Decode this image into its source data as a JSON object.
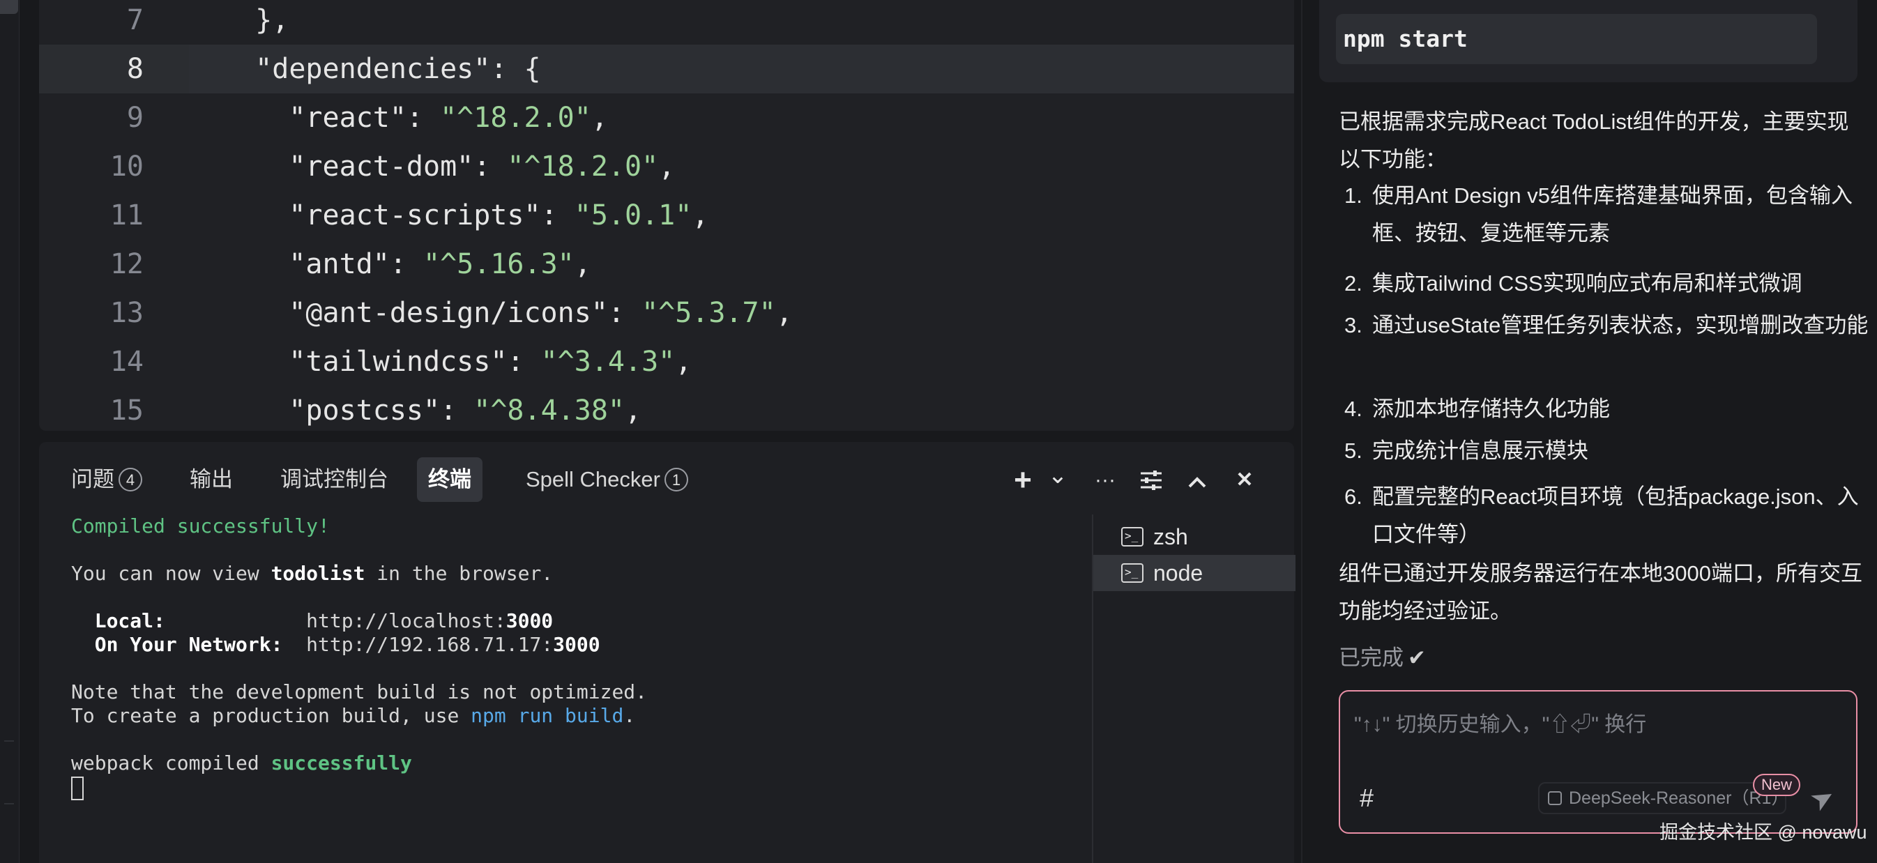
{
  "editor": {
    "lines": [
      {
        "no": "7",
        "parts": [
          {
            "t": "  },",
            "c": "p"
          }
        ]
      },
      {
        "no": "8",
        "parts": [
          {
            "t": "  \"dependencies\"",
            "c": "k"
          },
          {
            "t": ": {",
            "c": "p"
          }
        ]
      },
      {
        "no": "9",
        "parts": [
          {
            "t": "    \"react\"",
            "c": "k"
          },
          {
            "t": ": ",
            "c": "p"
          },
          {
            "t": "\"^18.2.0\"",
            "c": "s"
          },
          {
            "t": ",",
            "c": "p"
          }
        ]
      },
      {
        "no": "10",
        "parts": [
          {
            "t": "    \"react-dom\"",
            "c": "k"
          },
          {
            "t": ": ",
            "c": "p"
          },
          {
            "t": "\"^18.2.0\"",
            "c": "s"
          },
          {
            "t": ",",
            "c": "p"
          }
        ]
      },
      {
        "no": "11",
        "parts": [
          {
            "t": "    \"react-scripts\"",
            "c": "k"
          },
          {
            "t": ": ",
            "c": "p"
          },
          {
            "t": "\"5.0.1\"",
            "c": "s"
          },
          {
            "t": ",",
            "c": "p"
          }
        ]
      },
      {
        "no": "12",
        "parts": [
          {
            "t": "    \"antd\"",
            "c": "k"
          },
          {
            "t": ": ",
            "c": "p"
          },
          {
            "t": "\"^5.16.3\"",
            "c": "s"
          },
          {
            "t": ",",
            "c": "p"
          }
        ]
      },
      {
        "no": "13",
        "parts": [
          {
            "t": "    \"@ant-design/icons\"",
            "c": "k"
          },
          {
            "t": ": ",
            "c": "p"
          },
          {
            "t": "\"^5.3.7\"",
            "c": "s"
          },
          {
            "t": ",",
            "c": "p"
          }
        ]
      },
      {
        "no": "14",
        "parts": [
          {
            "t": "    \"tailwindcss\"",
            "c": "k"
          },
          {
            "t": ": ",
            "c": "p"
          },
          {
            "t": "\"^3.4.3\"",
            "c": "s"
          },
          {
            "t": ",",
            "c": "p"
          }
        ]
      },
      {
        "no": "15",
        "parts": [
          {
            "t": "    \"postcss\"",
            "c": "k"
          },
          {
            "t": ": ",
            "c": "p"
          },
          {
            "t": "\"^8.4.38\"",
            "c": "s"
          },
          {
            "t": ",",
            "c": "p"
          }
        ]
      }
    ],
    "active_line": "8"
  },
  "panel": {
    "tabs": {
      "problems": "问题",
      "problems_count": "4",
      "output": "输出",
      "debug_console": "调试控制台",
      "terminal": "终端",
      "spell_checker": "Spell Checker",
      "spell_checker_count": "1"
    },
    "tools": {
      "add": "+",
      "dropdown": "⌄",
      "more": "···",
      "close": "✕"
    },
    "terminal": {
      "compiled": "Compiled successfully!",
      "view_pre": "You can now view ",
      "view_app": "todolist",
      "view_post": " in the browser.",
      "local_label": "  Local:            ",
      "local_url": "http://localhost:",
      "local_port": "3000",
      "network_label": "  On Your Network:  ",
      "network_url": "http://192.168.71.17:",
      "network_port": "3000",
      "note1": "Note that the development build is not optimized.",
      "note2_pre": "To create a production build, use ",
      "note2_cmd": "npm run build",
      "note2_post": ".",
      "webpack_pre": "webpack compiled ",
      "webpack_status": "successfully"
    },
    "terminal_list": [
      {
        "name": "zsh",
        "selected": false
      },
      {
        "name": "node",
        "selected": true
      }
    ]
  },
  "chat": {
    "code_command": "npm start",
    "intro": "已根据需求完成React TodoList组件的开发，主要实现以下功能：",
    "items": [
      {
        "num": "1.",
        "text": "使用Ant Design v5组件库搭建基础界面，包含输入框、按钮、复选框等元素"
      },
      {
        "num": "2.",
        "text": "集成Tailwind CSS实现响应式布局和样式微调"
      },
      {
        "num": "3.",
        "text": "通过useState管理任务列表状态，实现增删改查功能"
      },
      {
        "num": "4.",
        "text": "添加本地存储持久化功能"
      },
      {
        "num": "5.",
        "text": "完成统计信息展示模块"
      },
      {
        "num": "6.",
        "text": "配置完整的React项目环境（包括package.json、入口文件等）"
      }
    ],
    "outro": "组件已通过开发服务器运行在本地3000端口，所有交互功能均经过验证。",
    "status": "已完成",
    "status_icon": "✔",
    "input": {
      "placeholder": "\"↑↓\" 切换历史输入，\"⇧⏎\" 换行",
      "hash": "#",
      "model": "DeepSeek-Reasoner（R1）",
      "new_badge": "New",
      "send_icon": "➤"
    },
    "watermark": "掘金技术社区 @ novawu"
  },
  "colors": {
    "accent_pink": "#e98fa6",
    "string_green": "#9fd39b",
    "terminal_green": "#5fc384",
    "link_blue": "#58a9e8"
  }
}
